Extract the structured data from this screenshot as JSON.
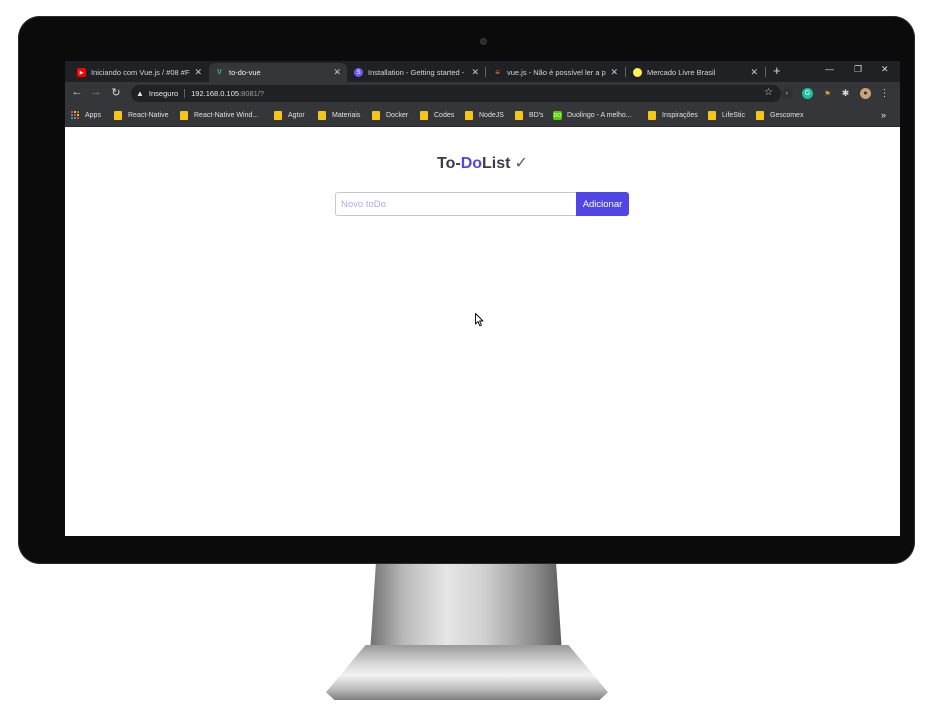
{
  "browser": {
    "tabs": [
      {
        "title": "Iniciando com Vue.js / #08 #F",
        "favicon": "youtube-icon",
        "color": "#ff0000",
        "active": false
      },
      {
        "title": "to-do-vue",
        "favicon": "vue-icon",
        "color": "#41b883",
        "active": true
      },
      {
        "title": "Installation - Getting started -",
        "favicon": "tailwind-icon",
        "color": "#6b5cf6",
        "active": false
      },
      {
        "title": "vue.js - Não é possível ler a pr",
        "favicon": "stackoverflow-icon",
        "color": "#f48024",
        "active": false
      },
      {
        "title": "Mercado Livre Brasil",
        "favicon": "mercadolivre-icon",
        "color": "#fff159",
        "active": false
      }
    ],
    "new_tab": "+",
    "close_glyph": "✕",
    "window_controls": {
      "minimize": "—",
      "maximize": "❐",
      "close": "✕"
    },
    "address": {
      "security_label": "Inseguro",
      "host": "192.168.0.105",
      "rest": ":8081/?"
    },
    "bookmarks": [
      {
        "label": "Apps",
        "type": "apps"
      },
      {
        "label": "React-Native",
        "type": "folder"
      },
      {
        "label": "React-Native Wind...",
        "type": "folder"
      },
      {
        "label": "Agtor",
        "type": "folder"
      },
      {
        "label": "Materiais",
        "type": "folder"
      },
      {
        "label": "Docker",
        "type": "folder"
      },
      {
        "label": "Codes",
        "type": "folder"
      },
      {
        "label": "NodeJS",
        "type": "folder"
      },
      {
        "label": "BD's",
        "type": "folder"
      },
      {
        "label": "Duolingo - A melho...",
        "type": "duolingo"
      },
      {
        "label": "Inspirações",
        "type": "folder"
      },
      {
        "label": "LifeStic",
        "type": "folder"
      },
      {
        "label": "Gescomex",
        "type": "folder"
      }
    ],
    "bookmarks_more": "»"
  },
  "app": {
    "title_part1": "To-",
    "title_part2": "Do",
    "title_part3": "List",
    "title_check": "✓",
    "input_placeholder": "Novo toDo",
    "add_button_label": "Adicionar"
  },
  "colors": {
    "accent": "#4f46e5",
    "tabbar": "#202124",
    "toolbar": "#35363a"
  }
}
